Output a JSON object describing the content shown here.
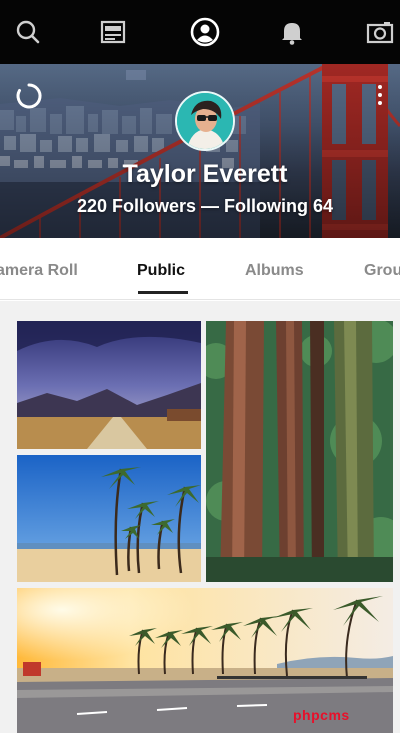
{
  "nav": {
    "icons": [
      "search-icon",
      "feed-icon",
      "profile-icon",
      "bell-icon",
      "camera-icon"
    ],
    "active": "profile-icon"
  },
  "profile": {
    "name": "Taylor Everett",
    "stats": "220 Followers — Following 64"
  },
  "tabs": {
    "items": [
      "amera Roll",
      "Public",
      "Albums",
      "Grou"
    ],
    "active_index": 1
  },
  "watermark": "phpcms",
  "colors": {
    "nav_bg": "#050505",
    "bridge_red": "#c2352d",
    "active_tab": "#111111",
    "inactive_tab": "#8a8a8a",
    "watermark": "#e8102a"
  }
}
